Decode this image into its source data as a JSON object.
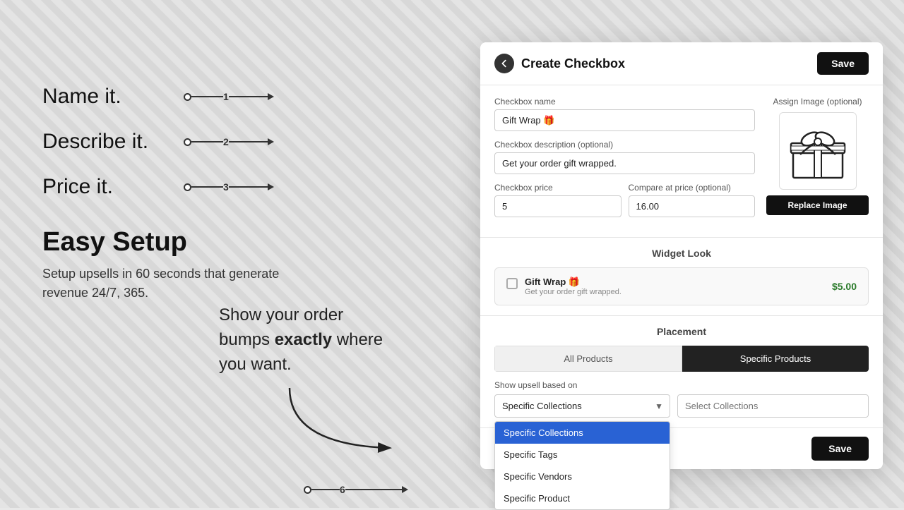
{
  "background": {
    "color": "#d8d8d8"
  },
  "steps": [
    {
      "label": "Name it.",
      "number": "1"
    },
    {
      "label": "Describe it.",
      "number": "2"
    },
    {
      "label": "Price it.",
      "number": "3"
    }
  ],
  "easy_setup": {
    "title": "Easy Setup",
    "description": "Setup upsells in 60 seconds that generate revenue 24/7, 365."
  },
  "placement_text": {
    "line1": "Show your order",
    "line2": "bumps",
    "bold": "exactly",
    "line3": "where",
    "line4": "you want."
  },
  "step6": {
    "number": "6"
  },
  "modal": {
    "title": "Create Checkbox",
    "save_label": "Save",
    "save_footer_label": "Save",
    "back_button": "back",
    "form": {
      "checkbox_name_label": "Checkbox name",
      "checkbox_name_value": "Gift Wrap 🎁",
      "checkbox_desc_label": "Checkbox description (optional)",
      "checkbox_desc_value": "Get your order gift wrapped.",
      "checkbox_price_label": "Checkbox price",
      "checkbox_price_value": "5",
      "compare_price_label": "Compare at price (optional)",
      "compare_price_value": "16.00",
      "assign_image_label": "Assign Image (optional)",
      "replace_image_btn": "Replace Image"
    },
    "widget_look": {
      "section_title": "Widget Look",
      "preview_name": "Gift Wrap 🎁",
      "preview_desc": "Get your order gift wrapped.",
      "preview_price": "$5.00"
    },
    "placement": {
      "section_title": "Placement",
      "tab_all": "All Products",
      "tab_specific": "Specific Products",
      "upsell_label": "Show upsell based on",
      "select_value": "Specific Collections",
      "select_options": [
        {
          "label": "Specific Collections",
          "selected": true
        },
        {
          "label": "Specific Tags",
          "selected": false
        },
        {
          "label": "Specific Vendors",
          "selected": false
        },
        {
          "label": "Specific Product",
          "selected": false
        }
      ],
      "collections_placeholder": "Select Collections"
    }
  }
}
